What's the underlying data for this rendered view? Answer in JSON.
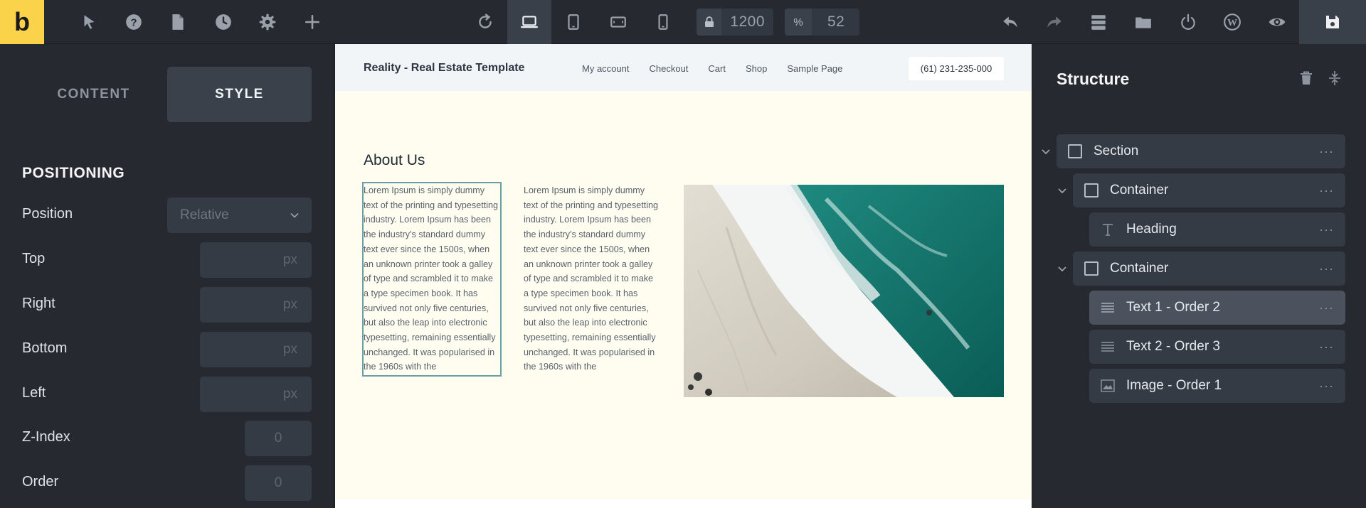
{
  "toolbar": {
    "logo": "b",
    "width_value": "1200",
    "percent_symbol": "%",
    "percent_value": "52"
  },
  "left_panel": {
    "tab_content": "CONTENT",
    "tab_style": "STYLE",
    "section": "POSITIONING",
    "controls": [
      {
        "label": "Position",
        "value": "Relative"
      },
      {
        "label": "Top",
        "unit": "px"
      },
      {
        "label": "Right",
        "unit": "px"
      },
      {
        "label": "Bottom",
        "unit": "px"
      },
      {
        "label": "Left",
        "unit": "px"
      },
      {
        "label": "Z-Index",
        "placeholder": "0"
      },
      {
        "label": "Order",
        "placeholder": "0"
      }
    ]
  },
  "canvas": {
    "site_title": "Reality - Real Estate Template",
    "nav": [
      "My account",
      "Checkout",
      "Cart",
      "Shop",
      "Sample Page"
    ],
    "phone": "(61) 231-235-000",
    "heading": "About Us",
    "paragraph1": "Lorem Ipsum is simply dummy text of the printing and typesetting industry. Lorem Ipsum has been the industry's standard dummy text ever since the 1500s, when an unknown printer took a galley of type and scrambled it to make a type specimen book. It has survived not only five centuries, but also the leap into electronic typesetting, remaining essentially unchanged. It was popularised in the 1960s with the",
    "paragraph2": "Lorem Ipsum is simply dummy text of the printing and typesetting industry. Lorem Ipsum has been the industry's standard dummy text ever since the 1500s, when an unknown printer took a galley of type and scrambled it to make a type specimen book. It has survived not only five centuries, but also the leap into electronic typesetting, remaining essentially unchanged. It was popularised in the 1960s with the"
  },
  "structure": {
    "title": "Structure",
    "items": [
      {
        "label": "Section",
        "icon": "box-icon"
      },
      {
        "label": "Container",
        "icon": "box-icon"
      },
      {
        "label": "Heading",
        "icon": "heading-icon"
      },
      {
        "label": "Container",
        "icon": "box-icon"
      },
      {
        "label": "Text 1 - Order 2",
        "icon": "text-icon",
        "selected": true
      },
      {
        "label": "Text 2 - Order 3",
        "icon": "text-icon"
      },
      {
        "label": "Image - Order 1",
        "icon": "image-icon"
      }
    ]
  },
  "colors": {
    "brand": "#fbd34a",
    "panel": "#262a30",
    "hero_bg": "#fefdf0",
    "selection": "#6a9fa4"
  }
}
